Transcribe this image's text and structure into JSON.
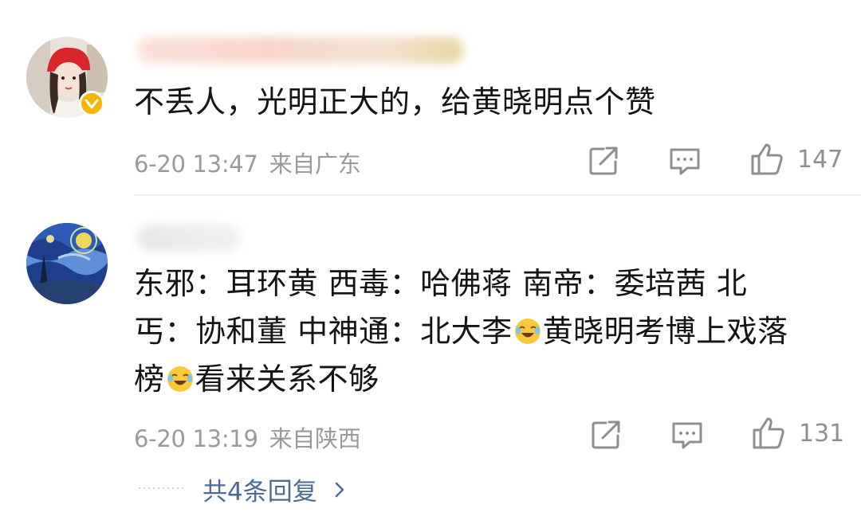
{
  "comments": [
    {
      "text": "不丢人，光明正大的，给黄晓明点个赞",
      "time": "6-20 13:47",
      "location": "来自广东",
      "likes": "147",
      "verified": true
    },
    {
      "text_parts": [
        "东邪：耳环黄  西毒：哈佛蒋  南帝：委培茜  北",
        "丐：协和董  中神通：北大李",
        "黄晓明考博上戏落",
        "榜",
        "看来关系不够"
      ],
      "time": "6-20 13:19",
      "location": "来自陕西",
      "likes": "131",
      "verified": false
    }
  ],
  "replies": {
    "label": "共4条回复"
  },
  "icons": {
    "share": "share-icon",
    "comment": "comment-icon",
    "like": "thumbs-up-icon",
    "emoji": "laugh-cry-emoji-icon",
    "reply_chevron": "chevron-right-icon",
    "verified": "verified-badge-icon"
  },
  "colors": {
    "text": "#141414",
    "meta": "#9a9a9a",
    "link": "#4e6a91",
    "badge": "#f7b500"
  }
}
